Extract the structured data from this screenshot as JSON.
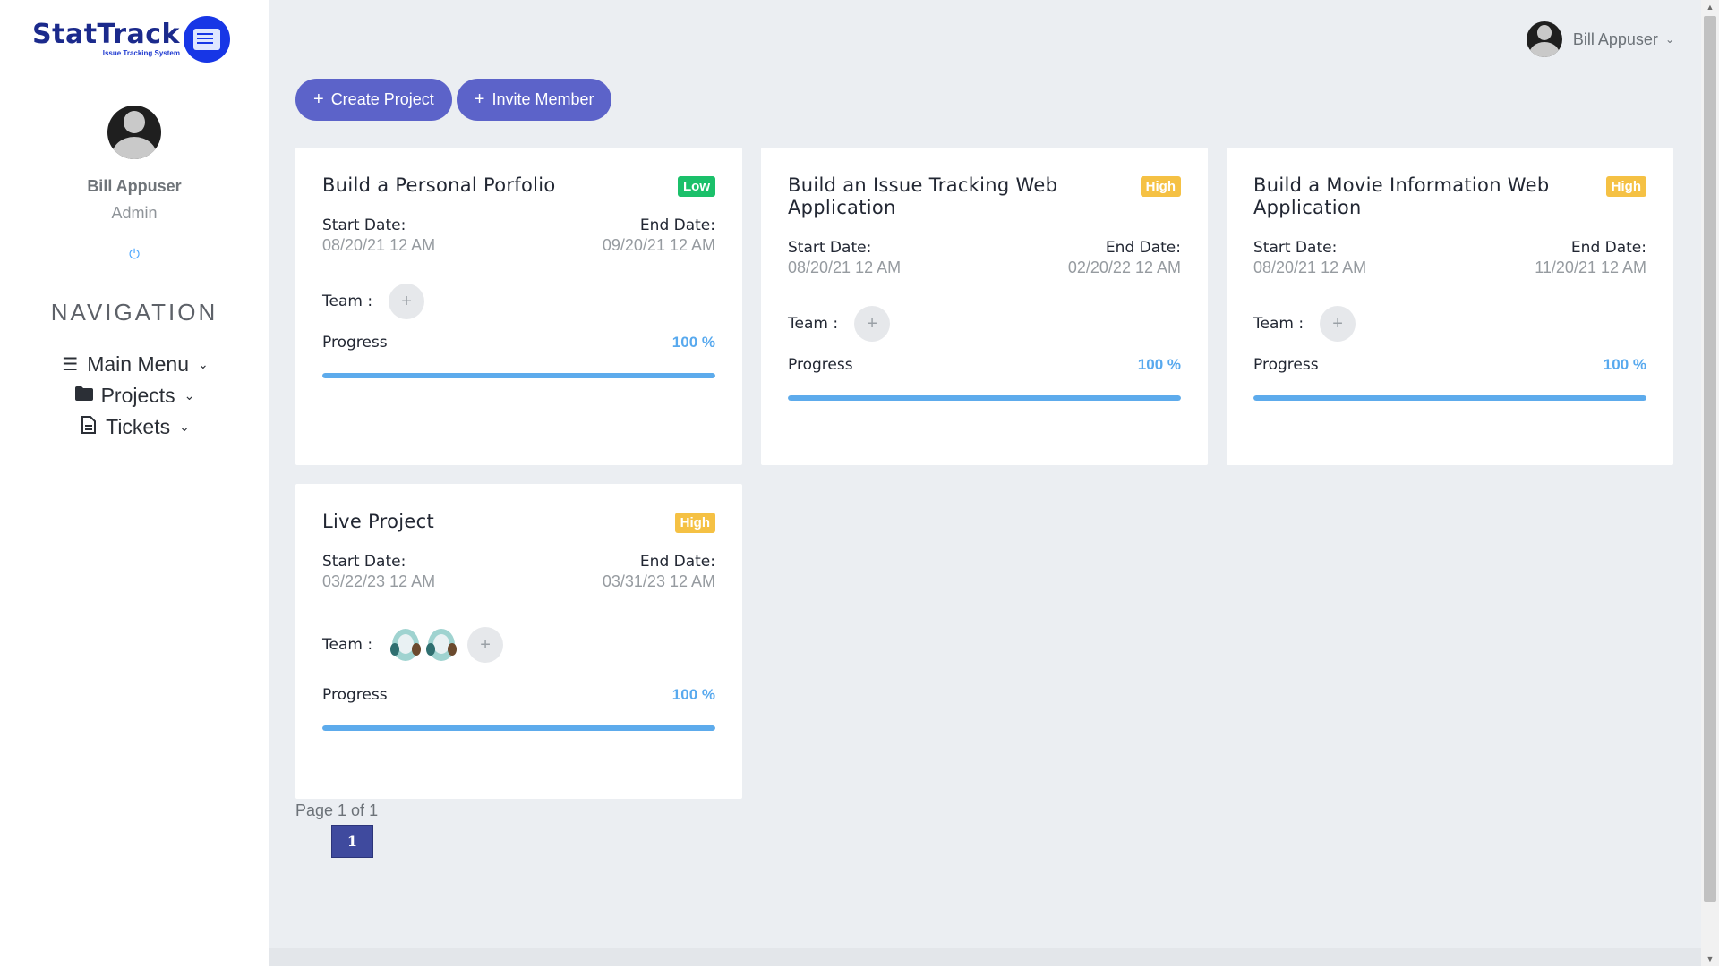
{
  "brand": {
    "name": "StatTrack",
    "subtitle": "Issue Tracking System"
  },
  "sidebar": {
    "user_name": "Bill Appuser",
    "user_role": "Admin",
    "power_icon": "⏻",
    "nav_title": "NAVIGATION",
    "items": [
      {
        "label": "Main Menu",
        "icon": "menu-icon"
      },
      {
        "label": "Projects",
        "icon": "folder-icon"
      },
      {
        "label": "Tickets",
        "icon": "document-icon"
      }
    ]
  },
  "header": {
    "user_name": "Bill Appuser"
  },
  "actions": {
    "create_label": "Create Project",
    "invite_label": "Invite Member"
  },
  "labels": {
    "start_date": "Start Date:",
    "end_date": "End Date:",
    "team": "Team :",
    "progress": "Progress",
    "add_member": "+"
  },
  "projects": [
    {
      "title": "Build a Personal Porfolio",
      "priority": "Low",
      "start": "08/20/21 12 AM",
      "end": "09/20/21 12 AM",
      "progress": 100,
      "progress_text": "100 %",
      "members": 0
    },
    {
      "title": "Build an Issue Tracking Web Application",
      "priority": "High",
      "start": "08/20/21 12 AM",
      "end": "02/20/22 12 AM",
      "progress": 100,
      "progress_text": "100 %",
      "members": 0
    },
    {
      "title": "Build a Movie Information Web Application",
      "priority": "High",
      "start": "08/20/21 12 AM",
      "end": "11/20/21 12 AM",
      "progress": 100,
      "progress_text": "100 %",
      "members": 0
    },
    {
      "title": "Live Project",
      "priority": "High",
      "start": "03/22/23 12 AM",
      "end": "03/31/23 12 AM",
      "progress": 100,
      "progress_text": "100 %",
      "members": 2
    }
  ],
  "pagination": {
    "text": "Page 1 of 1",
    "current": "1"
  },
  "colors": {
    "accent": "#5c63c9",
    "low": "#1bc06a",
    "high": "#f5c144",
    "progress": "#5dabec",
    "page_active": "#3f4a9e"
  }
}
